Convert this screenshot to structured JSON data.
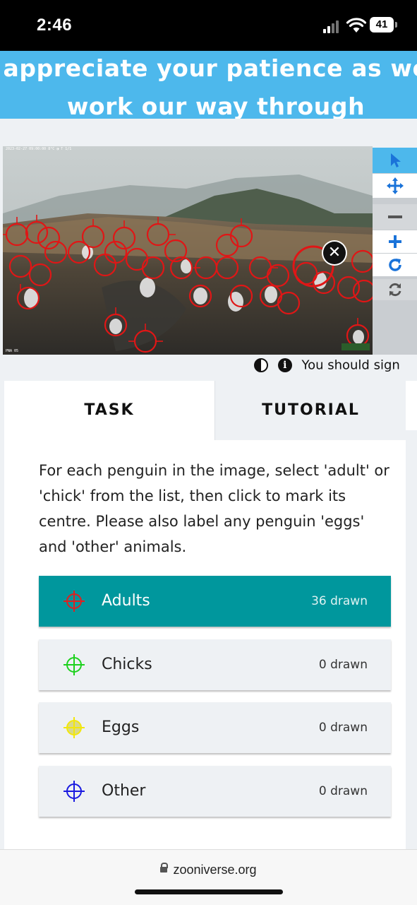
{
  "status_bar": {
    "time": "2:46",
    "battery": "41"
  },
  "banner": {
    "text": "appreciate your patience as we work our way through requests."
  },
  "viewer": {
    "timestamp": "2023-02-27 09:00:00     8°C ◑     T 1/1",
    "camera_id": "PNA 05",
    "close_icon": "close-circle-icon"
  },
  "toolbar": {
    "tools": [
      {
        "name": "select-tool",
        "icon": "cursor-arrow-icon",
        "glyph": "↖"
      },
      {
        "name": "move-tool",
        "icon": "move-arrows-icon",
        "glyph": "✥"
      },
      {
        "name": "zoom-out-tool",
        "icon": "minus-icon",
        "glyph": "−"
      },
      {
        "name": "zoom-in-tool",
        "icon": "plus-icon",
        "glyph": "+"
      },
      {
        "name": "rotate-tool",
        "icon": "rotate-icon",
        "glyph": "↻"
      },
      {
        "name": "reset-tool",
        "icon": "refresh-icon",
        "glyph": "↻"
      }
    ]
  },
  "info": {
    "text": "You should sign"
  },
  "tabs": {
    "task": "TASK",
    "tutorial": "TUTORIAL"
  },
  "task": {
    "instructions": "For each penguin in the image, select 'adult' or 'chick' from the list, then click to mark its centre. Please also label any penguin 'eggs' and 'other' animals.",
    "choices": [
      {
        "label": "Adults",
        "count": "36 drawn",
        "color": "#e02020",
        "selected": true
      },
      {
        "label": "Chicks",
        "count": "0 drawn",
        "color": "#1ed11e",
        "selected": false
      },
      {
        "label": "Eggs",
        "count": "0 drawn",
        "color": "#f2e70b",
        "selected": false
      },
      {
        "label": "Other",
        "count": "0 drawn",
        "color": "#1a1ae0",
        "selected": false
      }
    ]
  },
  "url_bar": {
    "url": "zooniverse.org"
  },
  "colors": {
    "banner": "#4db8ec",
    "selected": "#00979d",
    "marker": "#e02020"
  }
}
